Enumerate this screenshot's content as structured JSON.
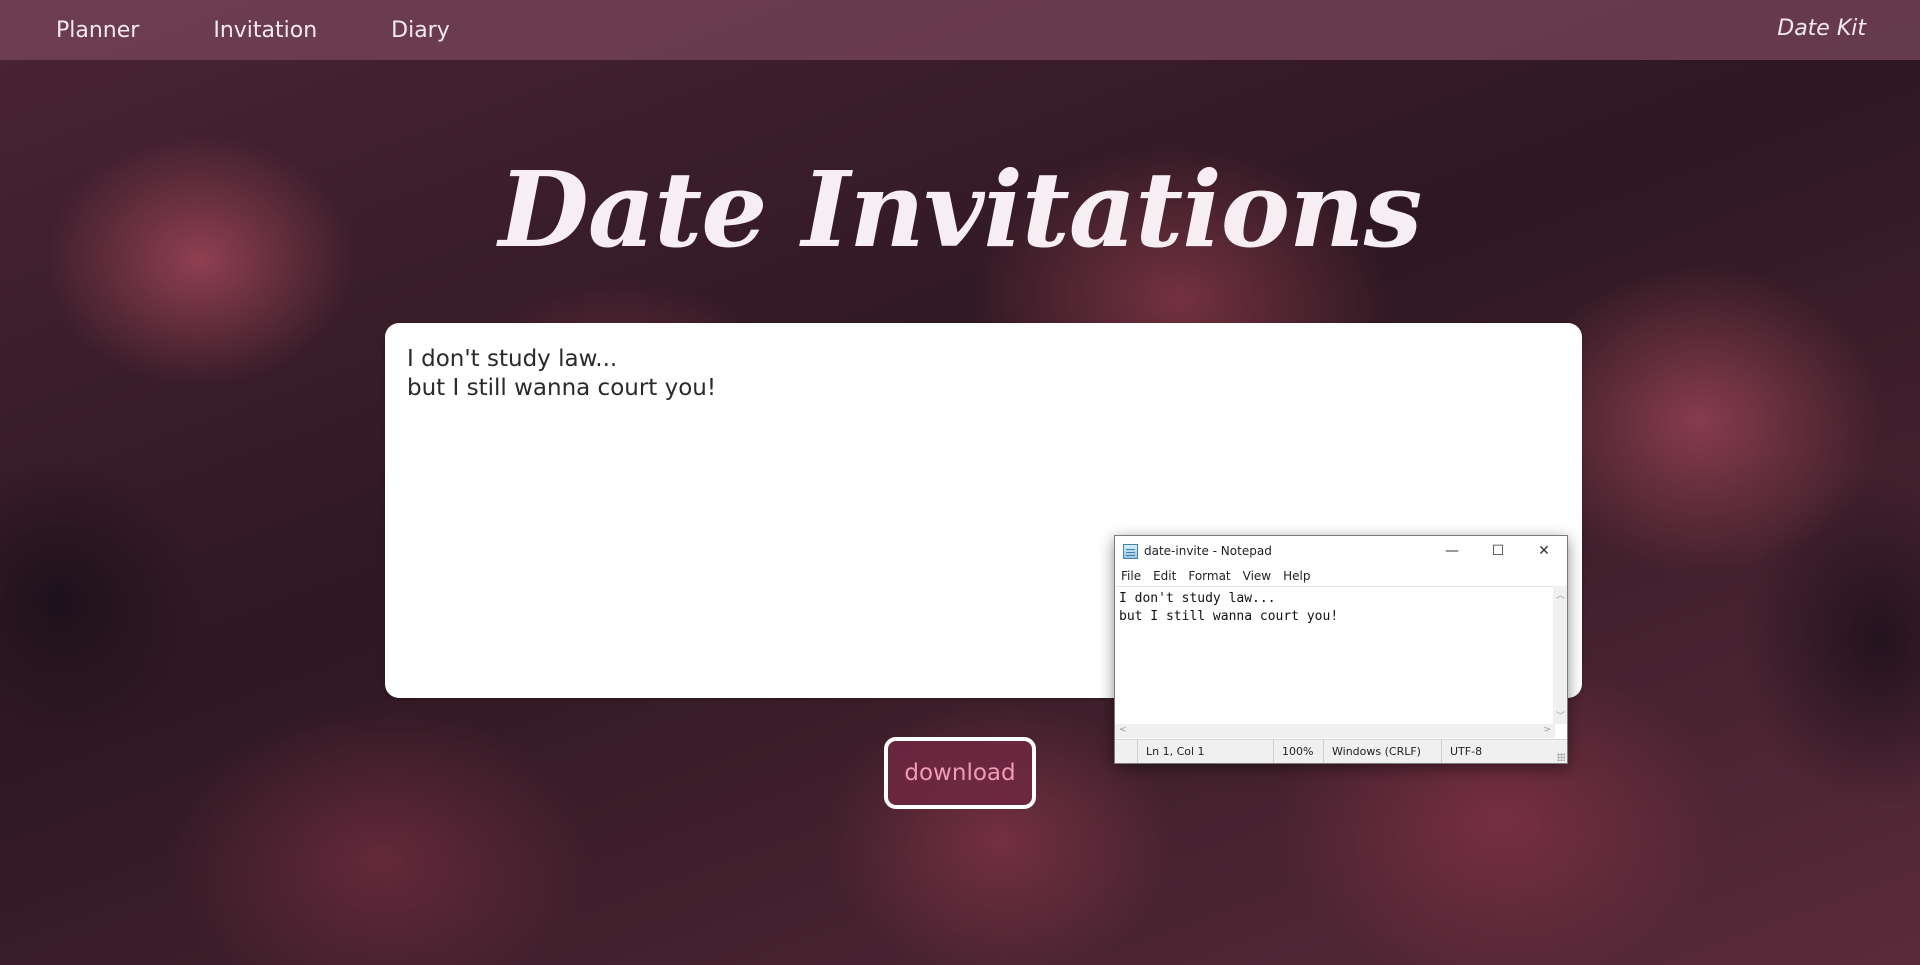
{
  "nav": {
    "links": [
      "Planner",
      "Invitation",
      "Diary"
    ],
    "brand": "Date Kit"
  },
  "page": {
    "title": "Date Invitations"
  },
  "invite": {
    "lines": [
      "I don't study law...",
      "but I still wanna court you!"
    ]
  },
  "download": {
    "label": "download"
  },
  "notepad": {
    "title": "date-invite - Notepad",
    "menu": [
      "File",
      "Edit",
      "Format",
      "View",
      "Help"
    ],
    "content_lines": [
      "I don't study law...",
      "but I still wanna court you!"
    ],
    "status": {
      "position": "Ln 1, Col 1",
      "zoom": "100%",
      "line_ending": "Windows (CRLF)",
      "encoding": "UTF-8"
    },
    "controls": {
      "minimize": "—",
      "maximize": "☐",
      "close": "✕"
    }
  },
  "colors": {
    "nav_bg": "#784659",
    "button_text": "#f39ab5",
    "title_text": "#f6eef3"
  }
}
